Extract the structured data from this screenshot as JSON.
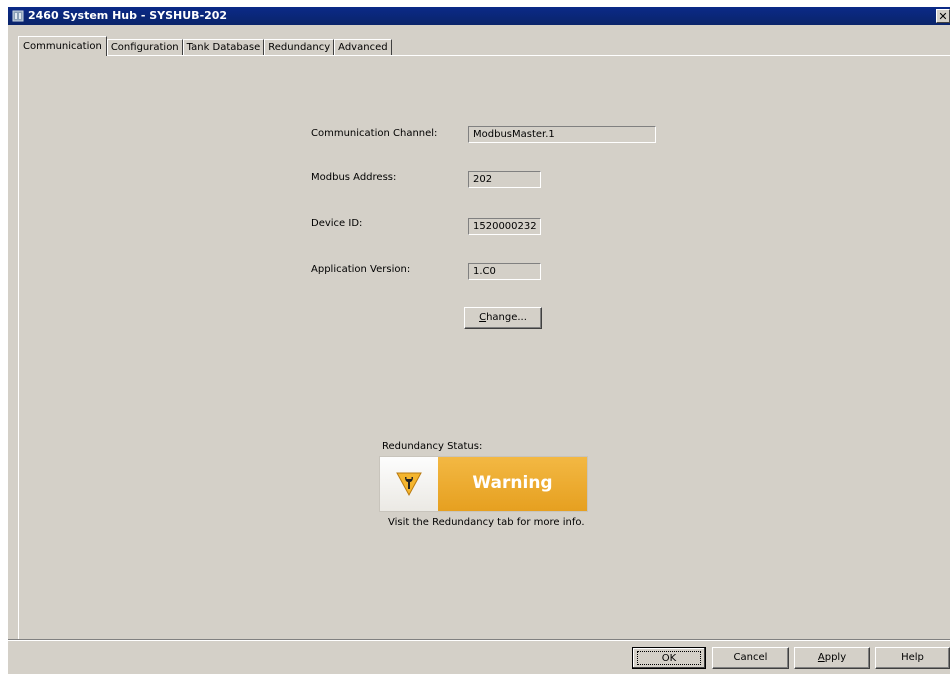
{
  "window": {
    "title": "2460 System Hub  - SYSHUB-202",
    "close_glyph": "✕"
  },
  "tabs": [
    {
      "label": "Communication",
      "active": true
    },
    {
      "label": "Configuration",
      "active": false
    },
    {
      "label": "Tank Database",
      "active": false
    },
    {
      "label": "Redundancy",
      "active": false
    },
    {
      "label": "Advanced",
      "active": false
    }
  ],
  "communication": {
    "channel_label": "Communication Channel:",
    "channel_value": "ModbusMaster.1",
    "modbus_label": "Modbus Address:",
    "modbus_value": "202",
    "device_id_label": "Device ID:",
    "device_id_value": "1520000232",
    "app_version_label": "Application Version:",
    "app_version_value": "1.C0",
    "change_button": {
      "mnemonic": "C",
      "rest": "hange..."
    }
  },
  "redundancy": {
    "status_label": "Redundancy Status:",
    "status_value": "Warning",
    "status_icon": "warning-wrench-icon",
    "hint": "Visit the Redundancy tab for more info.",
    "accent_color": "#e8a423"
  },
  "footer": {
    "ok_label": "OK",
    "cancel_label": "Cancel",
    "apply_button": {
      "mnemonic": "A",
      "rest": "pply"
    },
    "help_label": "Help"
  }
}
